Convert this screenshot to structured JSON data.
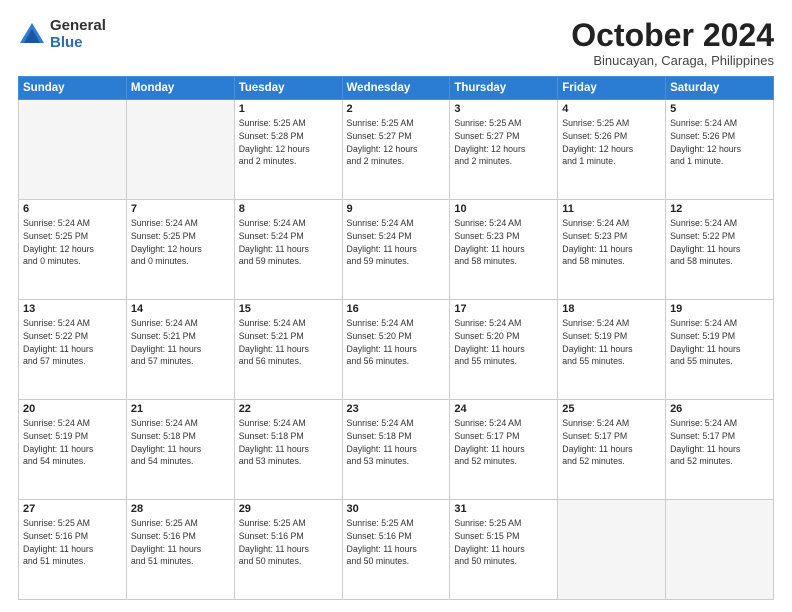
{
  "logo": {
    "general": "General",
    "blue": "Blue"
  },
  "title": "October 2024",
  "location": "Binucayan, Caraga, Philippines",
  "weekdays": [
    "Sunday",
    "Monday",
    "Tuesday",
    "Wednesday",
    "Thursday",
    "Friday",
    "Saturday"
  ],
  "days": [
    {
      "num": "",
      "info": ""
    },
    {
      "num": "",
      "info": ""
    },
    {
      "num": "1",
      "info": "Sunrise: 5:25 AM\nSunset: 5:28 PM\nDaylight: 12 hours\nand 2 minutes."
    },
    {
      "num": "2",
      "info": "Sunrise: 5:25 AM\nSunset: 5:27 PM\nDaylight: 12 hours\nand 2 minutes."
    },
    {
      "num": "3",
      "info": "Sunrise: 5:25 AM\nSunset: 5:27 PM\nDaylight: 12 hours\nand 2 minutes."
    },
    {
      "num": "4",
      "info": "Sunrise: 5:25 AM\nSunset: 5:26 PM\nDaylight: 12 hours\nand 1 minute."
    },
    {
      "num": "5",
      "info": "Sunrise: 5:24 AM\nSunset: 5:26 PM\nDaylight: 12 hours\nand 1 minute."
    },
    {
      "num": "6",
      "info": "Sunrise: 5:24 AM\nSunset: 5:25 PM\nDaylight: 12 hours\nand 0 minutes."
    },
    {
      "num": "7",
      "info": "Sunrise: 5:24 AM\nSunset: 5:25 PM\nDaylight: 12 hours\nand 0 minutes."
    },
    {
      "num": "8",
      "info": "Sunrise: 5:24 AM\nSunset: 5:24 PM\nDaylight: 11 hours\nand 59 minutes."
    },
    {
      "num": "9",
      "info": "Sunrise: 5:24 AM\nSunset: 5:24 PM\nDaylight: 11 hours\nand 59 minutes."
    },
    {
      "num": "10",
      "info": "Sunrise: 5:24 AM\nSunset: 5:23 PM\nDaylight: 11 hours\nand 58 minutes."
    },
    {
      "num": "11",
      "info": "Sunrise: 5:24 AM\nSunset: 5:23 PM\nDaylight: 11 hours\nand 58 minutes."
    },
    {
      "num": "12",
      "info": "Sunrise: 5:24 AM\nSunset: 5:22 PM\nDaylight: 11 hours\nand 58 minutes."
    },
    {
      "num": "13",
      "info": "Sunrise: 5:24 AM\nSunset: 5:22 PM\nDaylight: 11 hours\nand 57 minutes."
    },
    {
      "num": "14",
      "info": "Sunrise: 5:24 AM\nSunset: 5:21 PM\nDaylight: 11 hours\nand 57 minutes."
    },
    {
      "num": "15",
      "info": "Sunrise: 5:24 AM\nSunset: 5:21 PM\nDaylight: 11 hours\nand 56 minutes."
    },
    {
      "num": "16",
      "info": "Sunrise: 5:24 AM\nSunset: 5:20 PM\nDaylight: 11 hours\nand 56 minutes."
    },
    {
      "num": "17",
      "info": "Sunrise: 5:24 AM\nSunset: 5:20 PM\nDaylight: 11 hours\nand 55 minutes."
    },
    {
      "num": "18",
      "info": "Sunrise: 5:24 AM\nSunset: 5:19 PM\nDaylight: 11 hours\nand 55 minutes."
    },
    {
      "num": "19",
      "info": "Sunrise: 5:24 AM\nSunset: 5:19 PM\nDaylight: 11 hours\nand 55 minutes."
    },
    {
      "num": "20",
      "info": "Sunrise: 5:24 AM\nSunset: 5:19 PM\nDaylight: 11 hours\nand 54 minutes."
    },
    {
      "num": "21",
      "info": "Sunrise: 5:24 AM\nSunset: 5:18 PM\nDaylight: 11 hours\nand 54 minutes."
    },
    {
      "num": "22",
      "info": "Sunrise: 5:24 AM\nSunset: 5:18 PM\nDaylight: 11 hours\nand 53 minutes."
    },
    {
      "num": "23",
      "info": "Sunrise: 5:24 AM\nSunset: 5:18 PM\nDaylight: 11 hours\nand 53 minutes."
    },
    {
      "num": "24",
      "info": "Sunrise: 5:24 AM\nSunset: 5:17 PM\nDaylight: 11 hours\nand 52 minutes."
    },
    {
      "num": "25",
      "info": "Sunrise: 5:24 AM\nSunset: 5:17 PM\nDaylight: 11 hours\nand 52 minutes."
    },
    {
      "num": "26",
      "info": "Sunrise: 5:24 AM\nSunset: 5:17 PM\nDaylight: 11 hours\nand 52 minutes."
    },
    {
      "num": "27",
      "info": "Sunrise: 5:25 AM\nSunset: 5:16 PM\nDaylight: 11 hours\nand 51 minutes."
    },
    {
      "num": "28",
      "info": "Sunrise: 5:25 AM\nSunset: 5:16 PM\nDaylight: 11 hours\nand 51 minutes."
    },
    {
      "num": "29",
      "info": "Sunrise: 5:25 AM\nSunset: 5:16 PM\nDaylight: 11 hours\nand 50 minutes."
    },
    {
      "num": "30",
      "info": "Sunrise: 5:25 AM\nSunset: 5:16 PM\nDaylight: 11 hours\nand 50 minutes."
    },
    {
      "num": "31",
      "info": "Sunrise: 5:25 AM\nSunset: 5:15 PM\nDaylight: 11 hours\nand 50 minutes."
    },
    {
      "num": "",
      "info": ""
    },
    {
      "num": "",
      "info": ""
    }
  ]
}
